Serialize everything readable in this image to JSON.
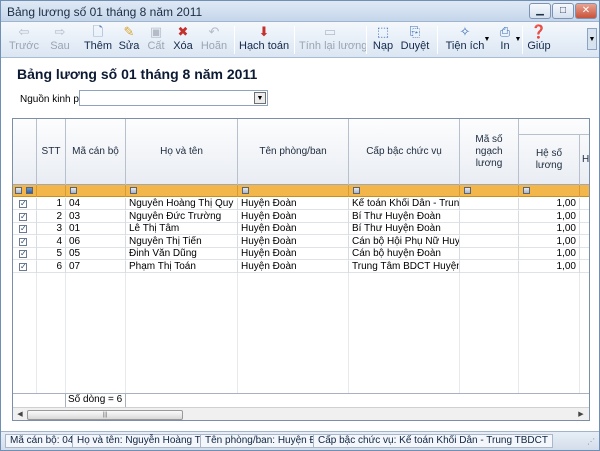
{
  "window": {
    "title": "Bảng lương số 01 tháng 8 năm 2011"
  },
  "toolbar": {
    "back": "Trước",
    "next": "Sau",
    "add": "Thêm",
    "edit": "Sửa",
    "save": "Cất",
    "delete": "Xóa",
    "undo": "Hoãn",
    "posting": "Hạch toán",
    "recalc": "Tính lại lương",
    "load": "Nạp",
    "approve": "Duyệt",
    "utilities": "Tiện ích",
    "print": "In",
    "help": "Giúp"
  },
  "page": {
    "title": "Bảng lương số 01 tháng 8 năm 2011"
  },
  "filter": {
    "label": "Nguồn kinh phí",
    "value": ""
  },
  "grid": {
    "headers": {
      "stt": "STT",
      "ma_can_bo": "Mã cán bộ",
      "ho_ten": "Họ và tên",
      "phong_ban": "Tên phòng/ban",
      "cap_bac": "Cấp bậc chức vụ",
      "ma_ngach": "Mã số ngạch lương",
      "he_so": "Hệ số lương",
      "next": "H"
    },
    "rows": [
      {
        "stt": "1",
        "ma": "04",
        "ten": "Nguyễn Hoàng Thị Quy",
        "phong": "Huyện Đoàn",
        "capbac": "Kế toán Khối Dân - Trung...",
        "ngach": "",
        "heso": "1,00"
      },
      {
        "stt": "2",
        "ma": "03",
        "ten": "Nguyễn Đức Trường",
        "phong": "Huyện Đoàn",
        "capbac": "Bí Thư Huyện Đoàn",
        "ngach": "",
        "heso": "1,00"
      },
      {
        "stt": "3",
        "ma": "01",
        "ten": "Lê Thị Tâm",
        "phong": "Huyện Đoàn",
        "capbac": "Bí Thư Huyện Đoàn",
        "ngach": "",
        "heso": "1,00"
      },
      {
        "stt": "4",
        "ma": "06",
        "ten": "Nguyễn Thị Tiến",
        "phong": "Huyện Đoàn",
        "capbac": "Cán bộ Hội Phụ Nữ Huyện...",
        "ngach": "",
        "heso": "1,00"
      },
      {
        "stt": "5",
        "ma": "05",
        "ten": "Đinh Văn Dũng",
        "phong": "Huyện Đoàn",
        "capbac": "Cán bộ huyện Đoàn",
        "ngach": "",
        "heso": "1,00"
      },
      {
        "stt": "6",
        "ma": "07",
        "ten": "Phạm Thị Toán",
        "phong": "Huyện Đoàn",
        "capbac": "Trung Tâm BDCT Huyện S...",
        "ngach": "",
        "heso": "1,00"
      }
    ],
    "summary": "Số dòng = 6"
  },
  "status": {
    "ma": "Mã cán bộ: 04",
    "ten": "Họ và tên: Nguyễn Hoàng Thị Quy",
    "phong": "Tên phòng/ban: Huyện Đoàn",
    "capbac": "Cấp bậc chức vụ: Kế toán Khối Dân - Trung TBDCT"
  },
  "colors": {
    "accent": "#f2b64a",
    "toolbar": "#dbe6f3",
    "titlebar": "#c5d6ea"
  },
  "icons": [
    "back-icon",
    "next-icon",
    "add-icon",
    "edit-icon",
    "save-icon",
    "delete-icon",
    "undo-icon",
    "posting-icon",
    "recalc-icon",
    "load-icon",
    "approve-icon",
    "utilities-icon",
    "print-icon",
    "help-icon"
  ]
}
